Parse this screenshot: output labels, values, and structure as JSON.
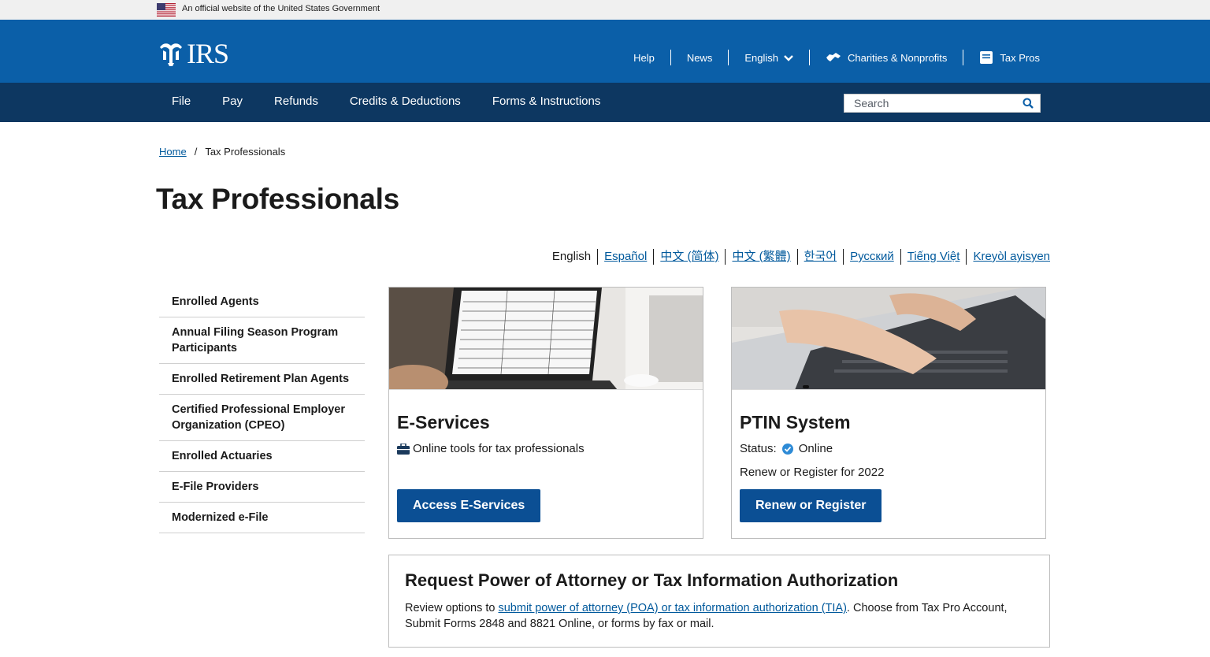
{
  "gov_banner": {
    "text": "An official website of the United States Government"
  },
  "header": {
    "logo_text": "IRS",
    "utility_nav": {
      "help": "Help",
      "news": "News",
      "language": "English",
      "charities": "Charities & Nonprofits",
      "tax_pros": "Tax Pros"
    }
  },
  "main_nav": {
    "items": [
      "File",
      "Pay",
      "Refunds",
      "Credits & Deductions",
      "Forms & Instructions"
    ],
    "search_placeholder": "Search"
  },
  "breadcrumb": {
    "home": "Home",
    "separator": "/",
    "current": "Tax Professionals"
  },
  "page_title": "Tax Professionals",
  "languages": [
    "English",
    "Español",
    "中文 (简体)",
    "中文 (繁體)",
    "한국어",
    "Русский",
    "Tiếng Việt",
    "Kreyòl ayisyen"
  ],
  "sidebar": {
    "items": [
      "Enrolled Agents",
      "Annual Filing Season Program Participants",
      "Enrolled Retirement Plan Agents",
      "Certified Professional Employer Organization (CPEO)",
      "Enrolled Actuaries",
      "E-File Providers",
      "Modernized e-File"
    ]
  },
  "eservices_card": {
    "title": "E-Services",
    "description": "Online tools for tax professionals",
    "button": "Access E-Services"
  },
  "ptin_card": {
    "title": "PTIN System",
    "status_label": "Status:",
    "status_value": "Online",
    "renew_text": "Renew or Register for 2022",
    "button": "Renew or Register"
  },
  "poa_card": {
    "title": "Request Power of Attorney or Tax Information Authorization",
    "text_before": "Review options to ",
    "link_text": "submit power of attorney (POA) or tax information authorization (TIA)",
    "text_after": ". Choose from Tax Pro Account, Submit Forms 2848 and 8821 Online, or forms by fax or mail."
  },
  "colors": {
    "header_blue": "#0b5fa8",
    "nav_navy": "#0d3761",
    "button_blue": "#0b4f94",
    "link_blue": "#00599c",
    "status_check": "#2e8bd6"
  }
}
